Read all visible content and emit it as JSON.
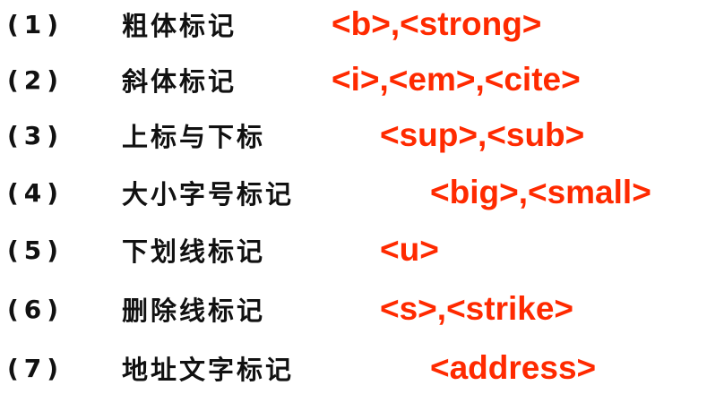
{
  "accent_color": "#ff2a00",
  "items": [
    {
      "number": "(1)",
      "label": "粗体标记",
      "tags": "<b>,<strong>"
    },
    {
      "number": "(2)",
      "label": "斜体标记",
      "tags": "<i>,<em>,<cite>"
    },
    {
      "number": "(3)",
      "label": "上标与下标",
      "tags": "<sup>,<sub>"
    },
    {
      "number": "(4)",
      "label": "大小字号标记",
      "tags": "<big>,<small>"
    },
    {
      "number": "(5)",
      "label": "下划线标记",
      "tags": "<u>"
    },
    {
      "number": "(6)",
      "label": "删除线标记",
      "tags": "<s>,<strike>"
    },
    {
      "number": "(7)",
      "label": "地址文字标记",
      "tags": "<address>"
    }
  ]
}
